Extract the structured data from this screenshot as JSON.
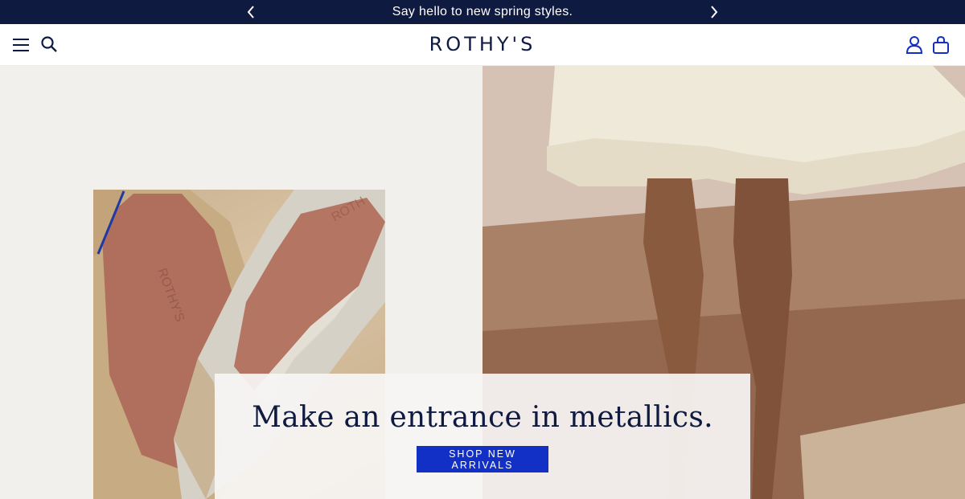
{
  "announcement": {
    "text": "Say hello to new spring styles.",
    "prev_icon": "chevron-left-icon",
    "next_icon": "chevron-right-icon"
  },
  "header": {
    "logo": "ROTHY'S",
    "left_icons": [
      "menu-icon",
      "search-icon"
    ],
    "right_icons": [
      "account-icon",
      "bag-icon"
    ]
  },
  "hero": {
    "headline": "Make an entrance in metallics.",
    "cta_label": "SHOP NEW ARRIVALS",
    "left_photo": "metallic-flat-shoes",
    "right_photo": "model-in-ruffled-dress"
  },
  "colors": {
    "navy": "#0f1a40",
    "accent_blue": "#1230c6",
    "hero_bg": "#f2f0ed"
  }
}
